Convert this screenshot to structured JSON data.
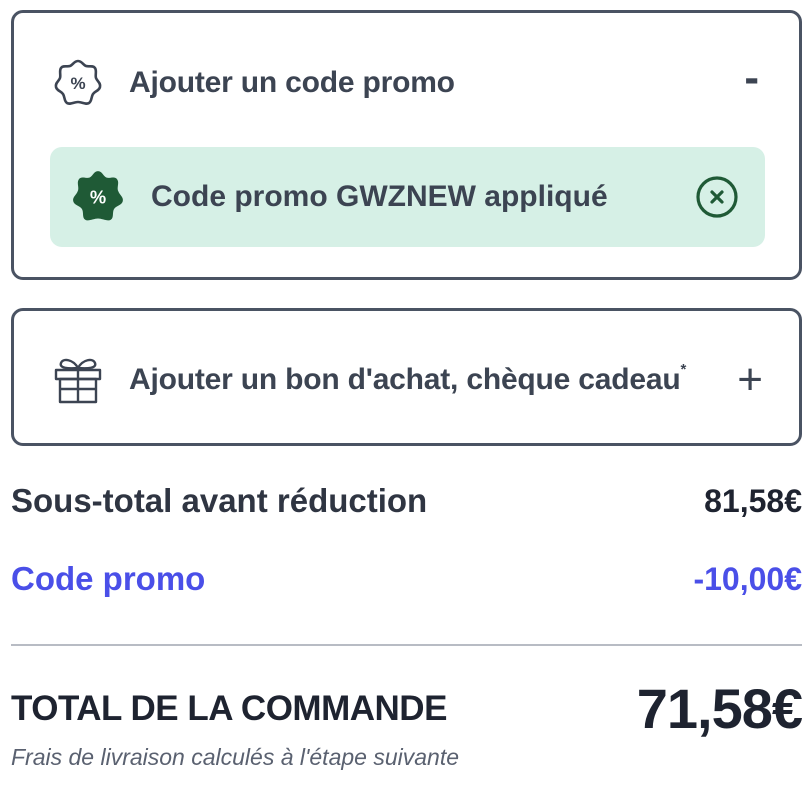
{
  "promo_section": {
    "title": "Ajouter un code promo",
    "toggle_symbol": "-",
    "icon": "percent-badge-icon",
    "applied": {
      "icon": "percent-badge-filled-icon",
      "percent_glyph": "%",
      "text": "Code promo GWZNEW appliqué",
      "remove_icon": "close-circle-icon",
      "background_color": "#d6f0e6",
      "accent_color": "#1f5a36"
    }
  },
  "gift_section": {
    "title": "Ajouter un bon d'achat, chèque cadeau",
    "title_suffix": "*",
    "toggle_symbol": "+",
    "icon": "gift-icon"
  },
  "summary": {
    "subtotal_label": "Sous-total avant réduction",
    "subtotal_value": "81,58€",
    "promo_label": "Code promo",
    "promo_value": "-10,00€",
    "promo_color": "#4a4fe8",
    "total_label": "TOTAL DE LA COMMANDE",
    "total_value": "71,58€",
    "shipping_note": "Frais de livraison calculés à l'étape suivante"
  }
}
